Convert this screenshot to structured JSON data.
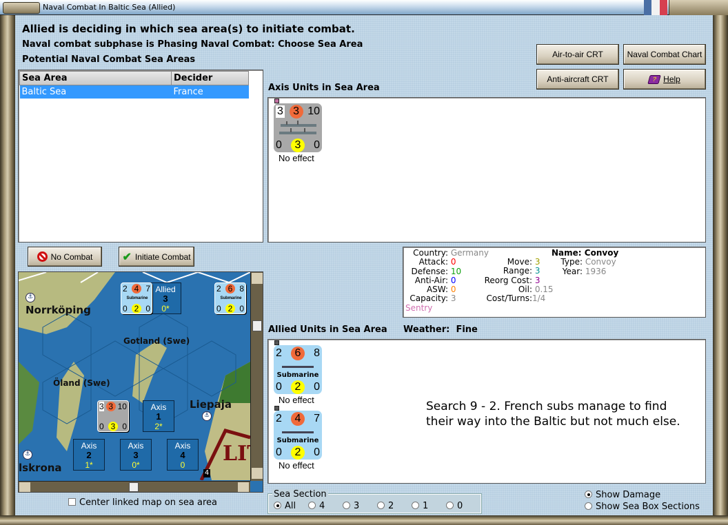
{
  "window": {
    "title": "Naval Combat In Baltic Sea (Allied)",
    "flag_colors": [
      "#4a6fa5",
      "#f2f2f2",
      "#d64050"
    ]
  },
  "header": {
    "headline": "Allied is deciding in which sea area(s) to initiate combat.",
    "subphase": "Naval combat subphase is Phasing Naval Combat: Choose Sea Area",
    "areas_label": "Potential Naval Combat Sea Areas"
  },
  "sea_table": {
    "columns": [
      "Sea Area",
      "Decider"
    ],
    "rows": [
      {
        "sea_area": "Baltic Sea",
        "decider": "France",
        "selected": true
      }
    ]
  },
  "buttons": {
    "no_combat": "No Combat",
    "initiate_combat": "Initiate Combat",
    "air_to_air": "Air-to-air CRT",
    "naval_chart": "Naval Combat Chart",
    "anti_aircraft": "Anti-aircraft CRT",
    "help": "Help"
  },
  "axis_units": {
    "label": "Axis Units in Sea Area",
    "units": [
      {
        "top": [
          "3",
          "3",
          "10"
        ],
        "bottom": [
          "0",
          "3",
          "0"
        ],
        "name": "",
        "result": "No effect",
        "type": "convoy"
      }
    ]
  },
  "unit_info": {
    "country_label": "Country:",
    "country": "Germany",
    "attack_label": "Attack:",
    "attack": "0",
    "defense_label": "Defense:",
    "defense": "10",
    "antiair_label": "Anti-Air:",
    "antiair": "0",
    "asw_label": "ASW:",
    "asw": "0",
    "capacity_label": "Capacity:",
    "capacity": "3",
    "move_label": "Move:",
    "move": "3",
    "range_label": "Range:",
    "range": "3",
    "reorg_label": "Reorg Cost:",
    "reorg": "3",
    "oil_label": "Oil:",
    "oil": "0.15",
    "cost_label": "Cost/Turns:",
    "cost": "1/4",
    "name_label": "Name:",
    "name": "Convoy",
    "type_label": "Type:",
    "type": "Convoy",
    "year_label": "Year:",
    "year": "1936",
    "status": "Sentry"
  },
  "allied_units": {
    "label": "Allied Units in Sea Area",
    "weather_label": "Weather:",
    "weather": "Fine",
    "units": [
      {
        "top": [
          "2",
          "6",
          "8"
        ],
        "bottom": [
          "0",
          "2",
          "0"
        ],
        "name": "Submarine",
        "result": "No effect"
      },
      {
        "top": [
          "2",
          "4",
          "7"
        ],
        "bottom": [
          "0",
          "2",
          "0"
        ],
        "name": "Submarine",
        "result": "No effect"
      }
    ]
  },
  "comment": "Search 9 - 2.  French subs manage to find their way into the Baltic but not much else.",
  "map": {
    "labels": {
      "norrkoping": "Norrköping",
      "gotland": "Gotland (Swe)",
      "oland": "Öland (Swe)",
      "liepaja": "Liepaja",
      "karlskrona": "lskrona",
      "lit": "LIT",
      "stack": "4"
    },
    "boxes": [
      {
        "side": "Allied",
        "num": "3",
        "val": "0*"
      },
      {
        "side": "Axis",
        "num": "1",
        "val": "2*"
      },
      {
        "side": "Axis",
        "num": "2",
        "val": "1*"
      },
      {
        "side": "Axis",
        "num": "3",
        "val": "0*"
      },
      {
        "side": "Axis",
        "num": "4",
        "val": "0"
      }
    ],
    "counters": [
      {
        "top": [
          "2",
          "4",
          "7"
        ],
        "bottom": [
          "0",
          "2",
          "0"
        ],
        "name": "Submarine"
      },
      {
        "top": [
          "2",
          "6",
          "8"
        ],
        "bottom": [
          "0",
          "2",
          "0"
        ],
        "name": "Submarine"
      },
      {
        "top": [
          "3",
          "3",
          "10"
        ],
        "bottom": [
          "0",
          "3",
          "0"
        ],
        "name": ""
      }
    ]
  },
  "center_map": {
    "label": "Center linked map on sea area",
    "checked": false
  },
  "sea_section": {
    "label": "Sea Section",
    "options": [
      "All",
      "4",
      "3",
      "2",
      "1",
      "0"
    ],
    "selected": "All"
  },
  "display": {
    "show_damage": "Show Damage",
    "show_sea_box": "Show Sea Box Sections",
    "selected": "Show Damage"
  }
}
